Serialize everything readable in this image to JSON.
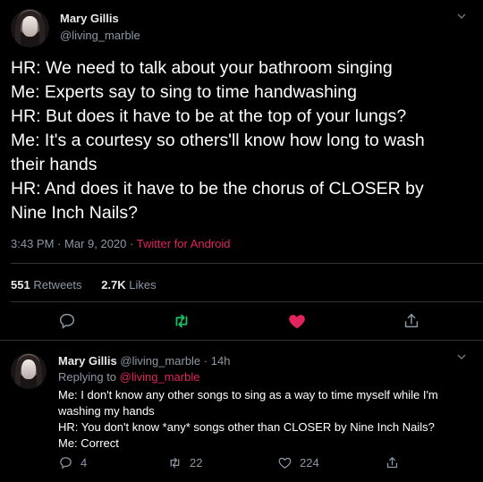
{
  "main_tweet": {
    "author_name": "Mary Gillis",
    "author_handle": "@living_marble",
    "lines": [
      "HR: We need to talk about your bathroom singing",
      "Me: Experts say to sing to time handwashing",
      "HR: But does it have to be at the top of your lungs?",
      "Me: It's a courtesy so others'll know how long to wash",
      "their hands",
      "HR: And does it have to be the chorus of CLOSER by",
      "Nine Inch Nails?"
    ],
    "time": "3:43 PM",
    "date": "Mar 9, 2020",
    "separator": "·",
    "source": "Twitter for Android",
    "retweets_count": "551",
    "retweets_label": "Retweets",
    "likes_count": "2.7K",
    "likes_label": "Likes",
    "liked": true,
    "colors": {
      "accent_like": "#e0245e",
      "retweet_icon": "#17bf63"
    }
  },
  "reply_tweet": {
    "author_name": "Mary Gillis",
    "author_handle": "@living_marble",
    "age": "14h",
    "separator": "·",
    "replying_prefix": "Replying to",
    "replying_handle": "@living_marble",
    "lines": [
      "Me: I don't know any other songs to sing as a way to time myself while I'm",
      "washing my hands",
      "HR: You don't know *any* songs other than CLOSER by Nine Inch Nails?",
      "Me: Correct"
    ],
    "reply_count": "4",
    "retweet_count": "22",
    "like_count": "224"
  },
  "icons": {
    "reply": "speech-bubble-icon",
    "retweet": "retweet-arrows-icon",
    "like": "heart-icon",
    "share": "share-upload-icon",
    "more": "chevron-down-icon"
  }
}
